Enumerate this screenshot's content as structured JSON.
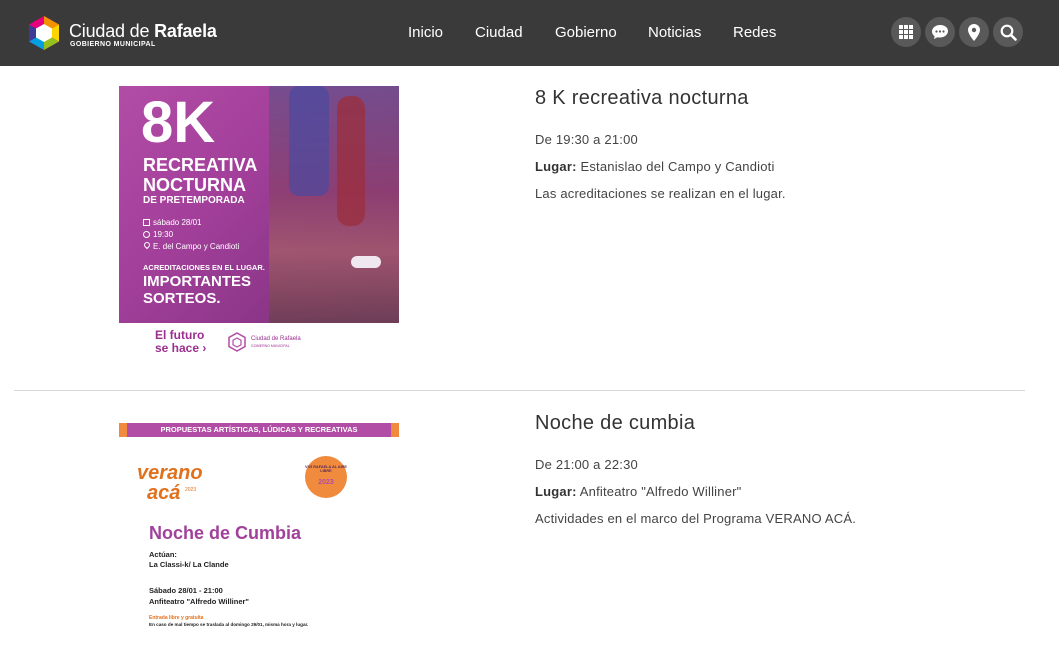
{
  "header": {
    "brand_name_light": "Ciudad de",
    "brand_name_bold": "Rafaela",
    "brand_sub": "GOBIERNO MUNICIPAL",
    "nav": [
      "Inicio",
      "Ciudad",
      "Gobierno",
      "Noticias",
      "Redes"
    ],
    "icons": [
      "grid-icon",
      "chat-icon",
      "location-pin-icon",
      "search-icon"
    ]
  },
  "events": [
    {
      "title": "8 K recreativa nocturna",
      "time": "De 19:30 a 21:00",
      "place_label": "Lugar:",
      "place": "Estanislao del Campo y Candioti",
      "note": "Las acreditaciones se realizan en el lugar.",
      "poster": {
        "big": "8K",
        "line1": "RECREATIVA",
        "line2": "NOCTURNA",
        "line3": "DE PRETEMPORADA",
        "date": "sábado 28/01",
        "time": "19:30",
        "place": "E. del Campo y Candioti",
        "accred": "ACREDITACIONES EN EL LUGAR.",
        "prizes1": "IMPORTANTES",
        "prizes2": "SORTEOS.",
        "slogan1": "El futuro",
        "slogan2": "se hace",
        "brand": "Ciudad de Rafaela",
        "brand_sub": "GOBIERNO MUNICIPAL"
      }
    },
    {
      "title": "Noche de cumbia",
      "time": "De 21:00 a 22:30",
      "place_label": "Lugar:",
      "place": "Anfiteatro \"Alfredo Williner\"",
      "note": "Actividades en el marco del Programa VERANO ACÁ.",
      "poster": {
        "banner": "PROPUESTAS ARTÍSTICAS, LÚDICAS Y RECREATIVAS",
        "logo1": "verano",
        "logo2": "acá",
        "logo_year": "2023",
        "badge_top": "VIVÍ RAFAELA AL AIRE LIBRE",
        "badge_year": "2023",
        "heading": "Noche de Cumbia",
        "acts_label": "Actúan:",
        "acts": "La Classi-k/ La Clande",
        "when": "Sábado 28/01 - 21:00",
        "where": "Anfiteatro \"Alfredo Williner\"",
        "free": "Entrada libre y gratuita",
        "rain": "En caso de mal tiempo se traslada al domingo 29/01, misma hora y lugar."
      }
    }
  ]
}
